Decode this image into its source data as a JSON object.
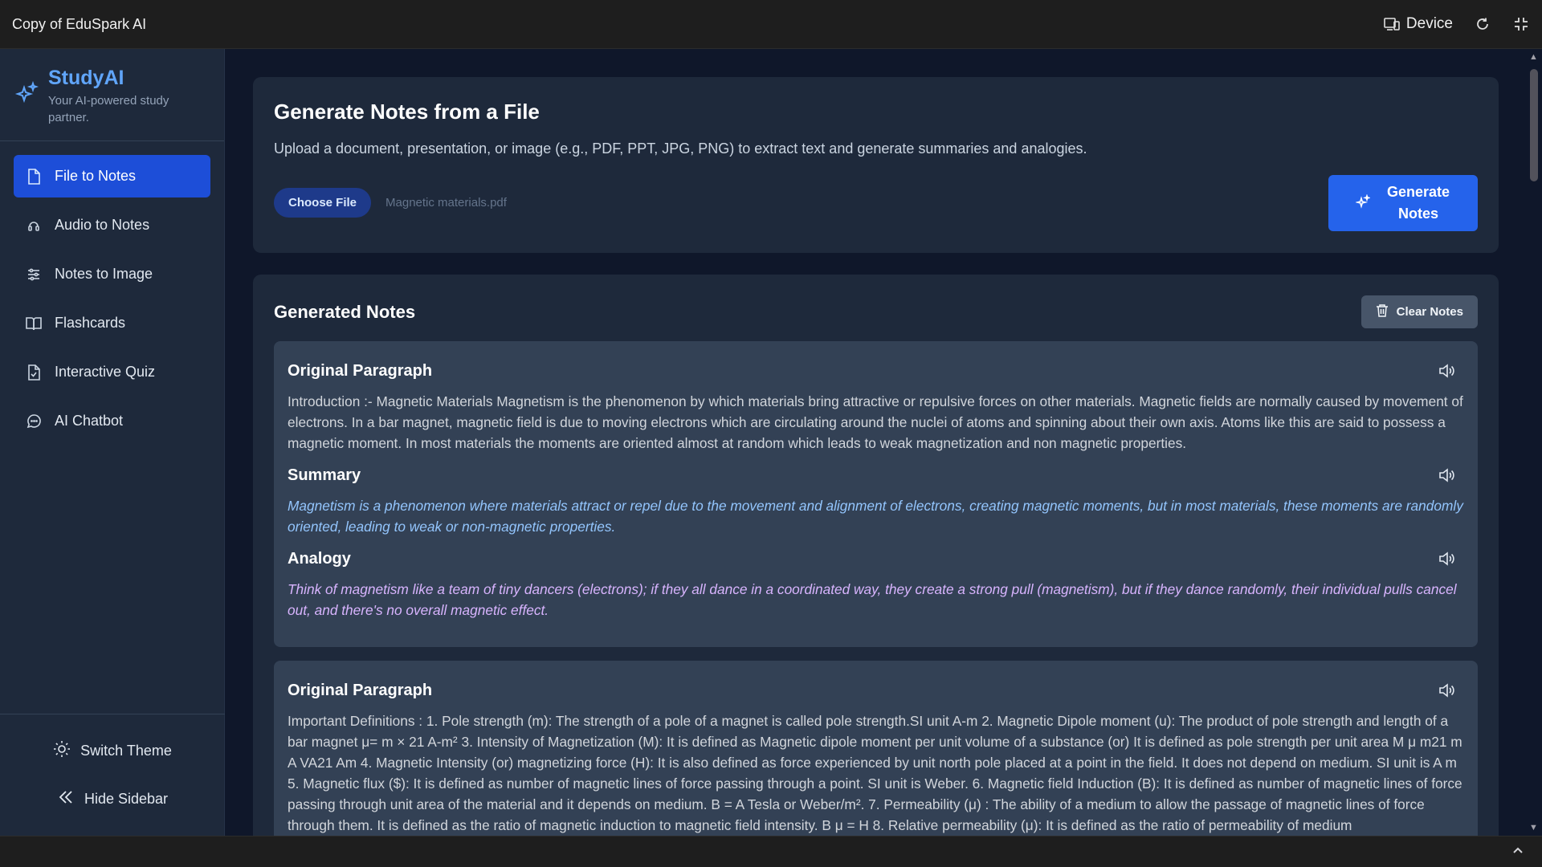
{
  "window": {
    "title": "Copy of EduSpark AI",
    "device_label": "Device"
  },
  "brand": {
    "name": "StudyAI",
    "tagline": "Your AI-powered study partner."
  },
  "sidebar": {
    "items": [
      {
        "label": "File to Notes",
        "icon": "file-icon",
        "active": true
      },
      {
        "label": "Audio to Notes",
        "icon": "audio-icon"
      },
      {
        "label": "Notes to Image",
        "icon": "sliders-icon"
      },
      {
        "label": "Flashcards",
        "icon": "book-icon"
      },
      {
        "label": "Interactive Quiz",
        "icon": "quiz-file-icon"
      },
      {
        "label": "AI Chatbot",
        "icon": "chat-icon"
      }
    ],
    "switch_theme": "Switch Theme",
    "hide_sidebar": "Hide Sidebar"
  },
  "upload": {
    "title": "Generate Notes from a File",
    "description": "Upload a document, presentation, or image (e.g., PDF, PPT, JPG, PNG) to extract text and generate summaries and analogies.",
    "choose_label": "Choose File",
    "file_name": "Magnetic materials.pdf",
    "generate_label": "Generate Notes"
  },
  "notes": {
    "title": "Generated Notes",
    "clear_label": "Clear Notes",
    "blocks": [
      {
        "original_title": "Original Paragraph",
        "original_text": "Introduction :- Magnetic Materials Magnetism is the phenomenon by which materials bring attractive or repulsive forces on other materials. Magnetic fields are normally caused by movement of electrons. In a bar magnet, magnetic field is due to moving electrons which are circulating around the nuclei of atoms and spinning about their own axis. Atoms like this are said to possess a magnetic moment. In most materials the moments are oriented almost at random which leads to weak magnetization and non magnetic properties.",
        "summary_title": "Summary",
        "summary_text": "Magnetism is a phenomenon where materials attract or repel due to the movement and alignment of electrons, creating magnetic moments, but in most materials, these moments are randomly oriented, leading to weak or non-magnetic properties.",
        "analogy_title": "Analogy",
        "analogy_text": "Think of magnetism like a team of tiny dancers (electrons); if they all dance in a coordinated way, they create a strong pull (magnetism), but if they dance randomly, their individual pulls cancel out, and there's no overall magnetic effect."
      },
      {
        "original_title": "Original Paragraph",
        "original_text": "Important Definitions : 1. Pole strength (m): The strength of a pole of a magnet is called pole strength.SI unit A-m 2. Magnetic Dipole moment (u): The product of pole strength and length of a bar magnet μ= m × 21 A-m² 3. Intensity of Magnetization (M): It is defined as Magnetic dipole moment per unit volume of a substance (or) It is defined as pole strength per unit area M μ m21 m A VA21 Am 4. Magnetic Intensity (or) magnetizing force (H): It is also defined as force experienced by unit north pole placed at a point in the field. It does not depend on medium. SI unit is A m 5. Magnetic flux ($): It is defined as number of magnetic lines of force passing through a point. SI unit is Weber. 6. Magnetic field Induction (B): It is defined as number of magnetic lines of force passing through unit area of the material and it depends on medium. B = A Tesla or Weber/m². 7. Permeability (μ) : The ability of a medium to allow the passage of magnetic lines of force through them. It is defined as the ratio of magnetic induction to magnetic field intensity. B μ = H 8. Relative permeability (μ): It is defined as the ratio of permeability of medium"
      }
    ]
  },
  "colors": {
    "accent": "#2563eb",
    "brand": "#60a5fa",
    "summary_text": "#93c5fd",
    "analogy_text": "#d8b4fe"
  }
}
